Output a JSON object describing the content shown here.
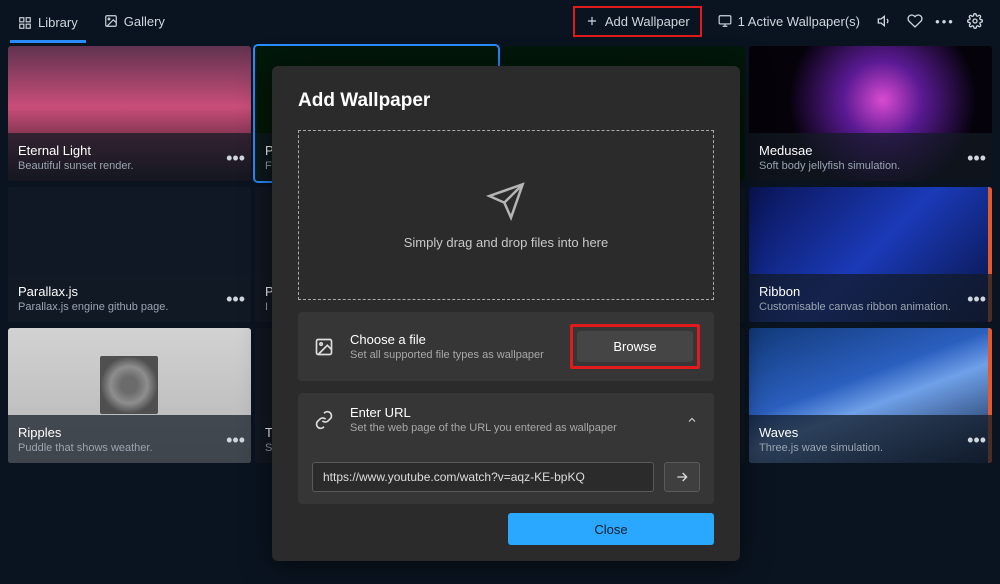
{
  "topbar": {
    "tabs": [
      {
        "label": "Library",
        "icon": "grid-icon",
        "active": true
      },
      {
        "label": "Gallery",
        "icon": "image-icon",
        "active": false
      }
    ],
    "add_wallpaper": "Add Wallpaper",
    "active_wallpapers": "1 Active Wallpaper(s)"
  },
  "cards": [
    {
      "title": "Eternal Light",
      "subtitle": "Beautiful sunset render.",
      "thumbClass": "g-sunset"
    },
    {
      "title": "P",
      "subtitle": "F",
      "thumbClass": "g-matrix",
      "selected": true
    },
    {
      "title": "",
      "subtitle": "",
      "thumbClass": "g-matrix"
    },
    {
      "title": "Medusae",
      "subtitle": "Soft body jellyfish simulation.",
      "thumbClass": "g-jelly"
    },
    {
      "title": "Parallax.js",
      "subtitle": "Parallax.js engine github page.",
      "thumbClass": "g-parallax"
    },
    {
      "title": "P",
      "subtitle": "I",
      "thumbClass": "g-blank"
    },
    {
      "title": "",
      "subtitle": "",
      "thumbClass": "g-blank"
    },
    {
      "title": "Ribbon",
      "subtitle": "Customisable canvas ribbon animation.",
      "thumbClass": "g-ribbon",
      "strip": true
    },
    {
      "title": "Ripples",
      "subtitle": "Puddle that shows weather.",
      "thumbClass": "g-ripples"
    },
    {
      "title": "T",
      "subtitle": "S",
      "thumbClass": "g-blank"
    },
    {
      "title": "",
      "subtitle": "",
      "thumbClass": "g-blank"
    },
    {
      "title": "Waves",
      "subtitle": "Three.js wave simulation.",
      "thumbClass": "g-waves",
      "strip": true
    }
  ],
  "modal": {
    "heading": "Add Wallpaper",
    "drop_hint": "Simply drag and drop files into here",
    "choose_title": "Choose a file",
    "choose_sub": "Set all supported file types as wallpaper",
    "browse": "Browse",
    "url_title": "Enter URL",
    "url_sub": "Set the web page of the URL you entered as wallpaper",
    "url_value": "https://www.youtube.com/watch?v=aqz-KE-bpKQ",
    "close": "Close"
  }
}
